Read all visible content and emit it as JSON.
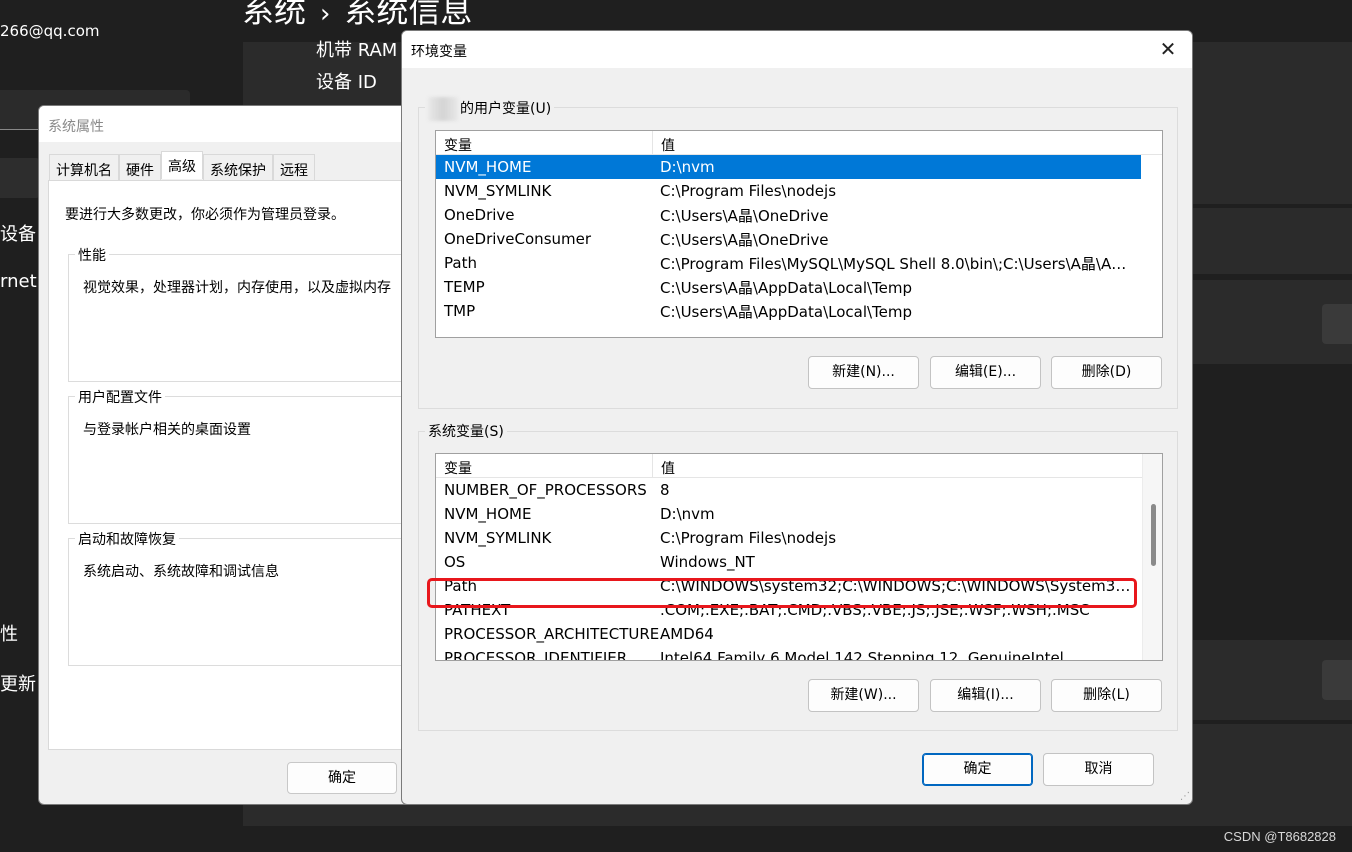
{
  "background_app": {
    "account_email": "266@qq.com",
    "breadcrumb": {
      "parent": "系统",
      "separator": "›",
      "current": "系统信息"
    },
    "nav_items": [
      "设备",
      "rnet",
      "性",
      "更新"
    ],
    "specs": [
      "机带 RAM",
      "设备 ID"
    ]
  },
  "system_properties": {
    "title": "系统属性",
    "tabs": [
      {
        "label": "计算机名"
      },
      {
        "label": "硬件"
      },
      {
        "label": "高级",
        "active": true
      },
      {
        "label": "系统保护"
      },
      {
        "label": "远程"
      }
    ],
    "admin_note": "要进行大多数更改，你必须作为管理员登录。",
    "groups": [
      {
        "label": "性能",
        "text": "视觉效果，处理器计划，内存使用，以及虚拟内存"
      },
      {
        "label": "用户配置文件",
        "text": "与登录帐户相关的桌面设置"
      },
      {
        "label": "启动和故障恢复",
        "text": "系统启动、系统故障和调试信息"
      }
    ],
    "ok_label": "确定"
  },
  "env_dialog": {
    "title": "环境变量",
    "close_glyph": "✕",
    "user_section": {
      "label_suffix": "的用户变量(U)",
      "columns": {
        "name": "变量",
        "value": "值"
      },
      "rows": [
        {
          "name": "NVM_HOME",
          "value": "D:\\nvm",
          "selected": true
        },
        {
          "name": "NVM_SYMLINK",
          "value": "C:\\Program Files\\nodejs"
        },
        {
          "name": "OneDrive",
          "value": "C:\\Users\\A晶\\OneDrive"
        },
        {
          "name": "OneDriveConsumer",
          "value": "C:\\Users\\A晶\\OneDrive"
        },
        {
          "name": "Path",
          "value": "C:\\Program Files\\MySQL\\MySQL Shell 8.0\\bin\\;C:\\Users\\A晶\\Ap..."
        },
        {
          "name": "TEMP",
          "value": "C:\\Users\\A晶\\AppData\\Local\\Temp"
        },
        {
          "name": "TMP",
          "value": "C:\\Users\\A晶\\AppData\\Local\\Temp"
        }
      ],
      "buttons": {
        "new": "新建(N)...",
        "edit": "编辑(E)...",
        "delete": "删除(D)"
      }
    },
    "system_section": {
      "label": "系统变量(S)",
      "columns": {
        "name": "变量",
        "value": "值"
      },
      "rows": [
        {
          "name": "NUMBER_OF_PROCESSORS",
          "value": "8"
        },
        {
          "name": "NVM_HOME",
          "value": "D:\\nvm"
        },
        {
          "name": "NVM_SYMLINK",
          "value": "C:\\Program Files\\nodejs"
        },
        {
          "name": "OS",
          "value": "Windows_NT"
        },
        {
          "name": "Path",
          "value": "C:\\WINDOWS\\system32;C:\\WINDOWS;C:\\WINDOWS\\System32\\...",
          "highlighted": true
        },
        {
          "name": "PATHEXT",
          "value": ".COM;.EXE;.BAT;.CMD;.VBS;.VBE;.JS;.JSE;.WSF;.WSH;.MSC"
        },
        {
          "name": "PROCESSOR_ARCHITECTURE",
          "value": "AMD64"
        },
        {
          "name": "PROCESSOR_IDENTIFIER",
          "value": "Intel64 Family 6 Model 142 Stepping 12, GenuineIntel"
        }
      ],
      "buttons": {
        "new": "新建(W)...",
        "edit": "编辑(I)...",
        "delete": "删除(L)"
      }
    },
    "ok_label": "确定",
    "cancel_label": "取消",
    "highlight_color": "#e8171c",
    "selection_color": "#0078d7"
  },
  "watermark": "CSDN @T8682828"
}
